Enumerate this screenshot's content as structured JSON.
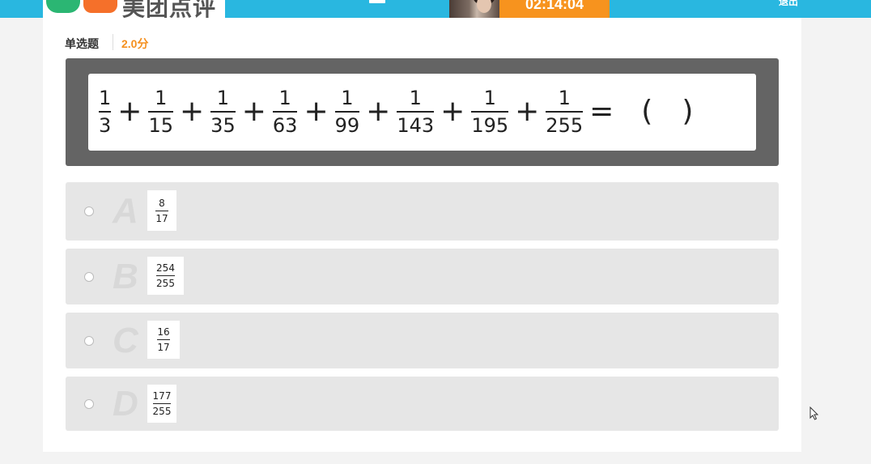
{
  "header": {
    "logo_text": "美团点评",
    "timer": "02:14:04",
    "exit_label": "退出"
  },
  "question": {
    "type_label": "单选题",
    "score": "2.0分",
    "stem": {
      "terms": [
        {
          "num": "1",
          "den": "3"
        },
        {
          "num": "1",
          "den": "15"
        },
        {
          "num": "1",
          "den": "35"
        },
        {
          "num": "1",
          "den": "63"
        },
        {
          "num": "1",
          "den": "99"
        },
        {
          "num": "1",
          "den": "143"
        },
        {
          "num": "1",
          "den": "195"
        },
        {
          "num": "1",
          "den": "255"
        }
      ],
      "plus": "+",
      "equals": "=",
      "blank_open": "(",
      "blank_close": ")"
    }
  },
  "options": [
    {
      "letter": "A",
      "num": "8",
      "den": "17"
    },
    {
      "letter": "B",
      "num": "254",
      "den": "255"
    },
    {
      "letter": "C",
      "num": "16",
      "den": "17"
    },
    {
      "letter": "D",
      "num": "177",
      "den": "255"
    }
  ],
  "colors": {
    "topbar": "#29b7e0",
    "timer_bg": "#f7931e",
    "score": "#f5901e",
    "stem_bg": "#646464",
    "option_bg": "#e6e6e6"
  }
}
